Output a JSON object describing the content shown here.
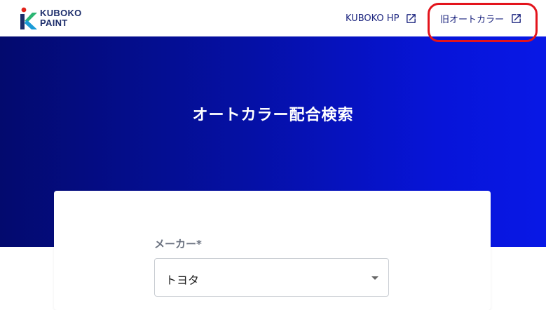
{
  "header": {
    "logo_line1": "KUBOKO",
    "logo_line2": "PAINT",
    "nav_hp_label": "KUBOKO HP",
    "nav_old_label": "旧オートカラー"
  },
  "hero": {
    "title": "オートカラー配合検索"
  },
  "form": {
    "maker_label": "メーカー*",
    "maker_value": "トヨタ"
  },
  "icons": {
    "external_link": "external-link-icon",
    "dropdown": "chevron-down-icon"
  },
  "colors": {
    "brand_navy": "#1c2d6b",
    "hero_gradient_start": "#030a6e",
    "hero_gradient_end": "#0818e6",
    "annotation_red": "#e3141c"
  }
}
